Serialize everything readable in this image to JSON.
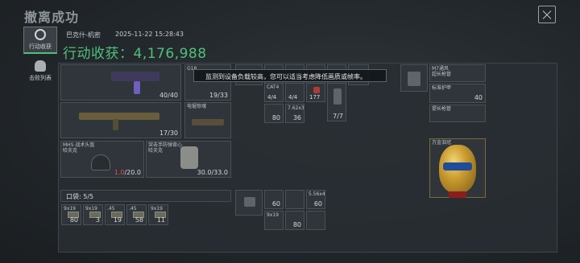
{
  "page": {
    "title": "撤离成功"
  },
  "sidebar": {
    "tabs": [
      {
        "label": "行动收获",
        "active": true
      },
      {
        "label": "击败列表",
        "active": false
      }
    ]
  },
  "header": {
    "name": "巴克什-机密",
    "timestamp": "2025-11-22 15:28:43",
    "total_label": "行动收获：4,176,988"
  },
  "tooltip": {
    "text": "监测到设备负载较高，您可以适当考虑降低画质或帧率。"
  },
  "equipment": {
    "primary_weapon": {
      "count": "40/40"
    },
    "secondary_weapon": {
      "count": "17/30"
    },
    "pistol": {
      "name": "G18",
      "count": "19/33"
    },
    "melee": {
      "name": "电锯惊魂"
    },
    "helmet": {
      "name_line1": "MHS 战术头盔",
      "name_line2": "哈夫克",
      "durability_current": "1.0",
      "durability_max": "/20.0"
    },
    "armor": {
      "name_line1": "突击手防弹背心",
      "name_line2": "哈夫克",
      "durability": "30.0/33.0"
    }
  },
  "rig": {
    "items": [
      {
        "name": "CAT4",
        "count": ""
      },
      {
        "name": "",
        "count": "4/4"
      },
      {
        "name": "",
        "count": "4/4"
      },
      {
        "name": "",
        "count": "177"
      },
      {
        "name": "",
        "count": "7/7"
      },
      {
        "name": "",
        "count": "80"
      },
      {
        "name": "",
        "count": "36"
      },
      {
        "name": "7.62x3",
        "count": ""
      }
    ]
  },
  "pocket": {
    "label": "口袋: 5/5",
    "items": [
      {
        "name": "9x19",
        "count": "80"
      },
      {
        "name": "9x19",
        "count": "3"
      },
      {
        "name": ".45",
        "count": "19"
      },
      {
        "name": ".45",
        "count": "58"
      },
      {
        "name": "9x19",
        "count": "11"
      }
    ]
  },
  "backpack": {
    "items": [
      {
        "name": "",
        "count": ""
      },
      {
        "name": "",
        "count": "60"
      },
      {
        "name": "",
        "count": "80"
      },
      {
        "name": "",
        "count": "60"
      },
      {
        "name": "5.56x4",
        "count": ""
      },
      {
        "name": "9x19",
        "count": ""
      }
    ]
  },
  "stash": {
    "items": [
      {
        "name": "M7通风",
        "sub": "超长枪管"
      },
      {
        "name": "标准护甲",
        "count": "40"
      },
      {
        "name": "提长枪管",
        "count": ""
      },
      {
        "name": "万金泪冠",
        "count": ""
      }
    ]
  }
}
